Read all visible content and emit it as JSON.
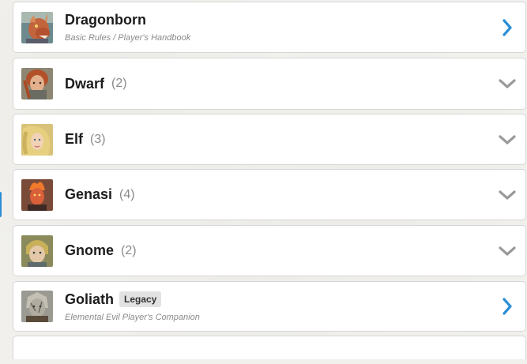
{
  "races": [
    {
      "name": "Dragonborn",
      "source": "Basic Rules / Player's Handbook",
      "count": "",
      "badge": "",
      "icon": "chevron-right-icon"
    },
    {
      "name": "Dwarf",
      "source": "",
      "count": "(2)",
      "badge": "",
      "icon": "chevron-down-icon"
    },
    {
      "name": "Elf",
      "source": "",
      "count": "(3)",
      "badge": "",
      "icon": "chevron-down-icon"
    },
    {
      "name": "Genasi",
      "source": "",
      "count": "(4)",
      "badge": "",
      "icon": "chevron-down-icon"
    },
    {
      "name": "Gnome",
      "source": "",
      "count": "(2)",
      "badge": "",
      "icon": "chevron-down-icon"
    },
    {
      "name": "Goliath",
      "source": "Elemental Evil Player's Companion",
      "count": "",
      "badge": "Legacy",
      "icon": "chevron-right-icon"
    }
  ],
  "colors": {
    "accent": "#2b8fd6",
    "chevron_gray": "#9a9a9a",
    "card_border": "#d6d6d6"
  }
}
